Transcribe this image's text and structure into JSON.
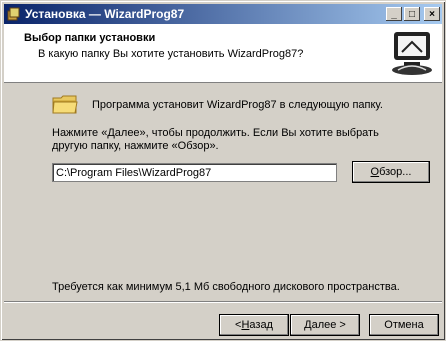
{
  "window": {
    "title": "Установка — WizardProg87",
    "controls": {
      "minimize": "_",
      "maximize": "□",
      "close": "×"
    }
  },
  "header": {
    "title": "Выбор папки установки",
    "subtitle": "В какую папку Вы хотите установить WizardProg87?"
  },
  "main": {
    "intro": "Программа установит WizardProg87 в следующую папку.",
    "instructions": "Нажмите «Далее», чтобы продолжить. Если Вы хотите выбрать другую папку, нажмите «Обзор».",
    "path_value": "C:\\Program Files\\WizardProg87",
    "browse": {
      "key": "О",
      "rest": "бзор..."
    },
    "requirement": "Требуется как минимум 5,1 Мб свободного дискового пространства."
  },
  "footer": {
    "back": {
      "prefix": "< ",
      "key": "Н",
      "rest": "азад"
    },
    "next": {
      "key": "Д",
      "rest": "алее >"
    },
    "cancel": "Отмена"
  },
  "colors": {
    "titlebar_start": "#0a246a",
    "titlebar_end": "#a6caf0",
    "face": "#d4d0c8"
  }
}
